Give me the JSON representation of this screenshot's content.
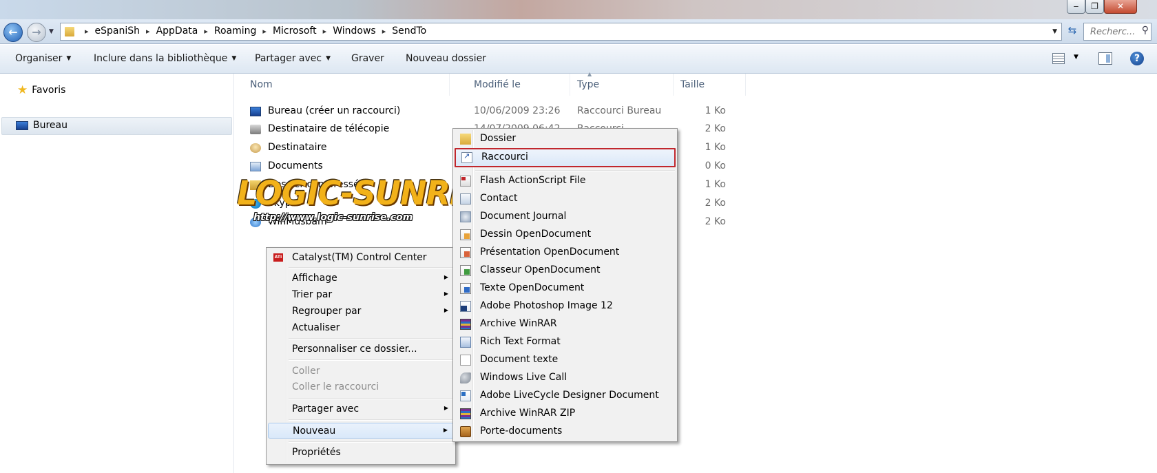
{
  "window": {
    "minimize_glyph": "‒",
    "maximize_glyph": "❐",
    "close_glyph": "✕"
  },
  "address": {
    "crumbs": [
      "eSpaniSh",
      "AppData",
      "Roaming",
      "Microsoft",
      "Windows",
      "SendTo"
    ],
    "separator": "▸",
    "search_placeholder": "Recherc..."
  },
  "commandbar": {
    "organize": "Organiser",
    "include": "Inclure dans la bibliothèque",
    "share": "Partager avec",
    "burn": "Graver",
    "new_folder": "Nouveau dossier"
  },
  "navpane": {
    "favorites": "Favoris",
    "desktop": "Bureau"
  },
  "columns": {
    "name": "Nom",
    "modified": "Modifié le",
    "type": "Type",
    "size": "Taille"
  },
  "files": [
    {
      "name": "Bureau (créer un raccourci)",
      "date": "10/06/2009 23:26",
      "type": "Raccourci Bureau",
      "size": "1 Ko",
      "icon": "desktop-icon"
    },
    {
      "name": "Destinataire de télécopie",
      "date": "14/07/2009 06:42",
      "type": "Raccourci",
      "size": "2 Ko",
      "icon": "fax-icon"
    },
    {
      "name": "Destinataire",
      "date": "",
      "type": "",
      "size": "1 Ko",
      "icon": "mail-recipient-icon"
    },
    {
      "name": "Documents",
      "date": "",
      "type": "",
      "size": "0 Ko",
      "icon": "documents-icon"
    },
    {
      "name": "Dossier compressé",
      "date": "",
      "type": "",
      "size": "1 Ko",
      "icon": "zip-folder-icon"
    },
    {
      "name": "Skype",
      "date": "",
      "type": "",
      "size": "2 Ko",
      "icon": "skype-icon"
    },
    {
      "name": "WinMusbam",
      "date": "",
      "type": "",
      "size": "2 Ko",
      "icon": "app-icon"
    }
  ],
  "watermark": {
    "title": "LOGIC-SUNRISE",
    "url": "http://www.logic-sunrise.com"
  },
  "context_menu": {
    "catalyst": "Catalyst(TM) Control Center",
    "view": "Affichage",
    "sort": "Trier par",
    "group": "Regrouper par",
    "refresh": "Actualiser",
    "customize": "Personnaliser ce dossier...",
    "paste": "Coller",
    "paste_shortcut": "Coller le raccourci",
    "share": "Partager avec",
    "new": "Nouveau",
    "properties": "Propriétés"
  },
  "new_submenu": [
    "Dossier",
    "Raccourci",
    "Flash ActionScript File",
    "Contact",
    "Document Journal",
    "Dessin OpenDocument",
    "Présentation OpenDocument",
    "Classeur OpenDocument",
    "Texte OpenDocument",
    "Adobe Photoshop Image 12",
    "Archive WinRAR",
    "Rich Text Format",
    "Document texte",
    "Windows Live Call",
    "Adobe LiveCycle Designer Document",
    "Archive WinRAR ZIP",
    "Porte-documents"
  ],
  "highlight_color": "#c1272d"
}
